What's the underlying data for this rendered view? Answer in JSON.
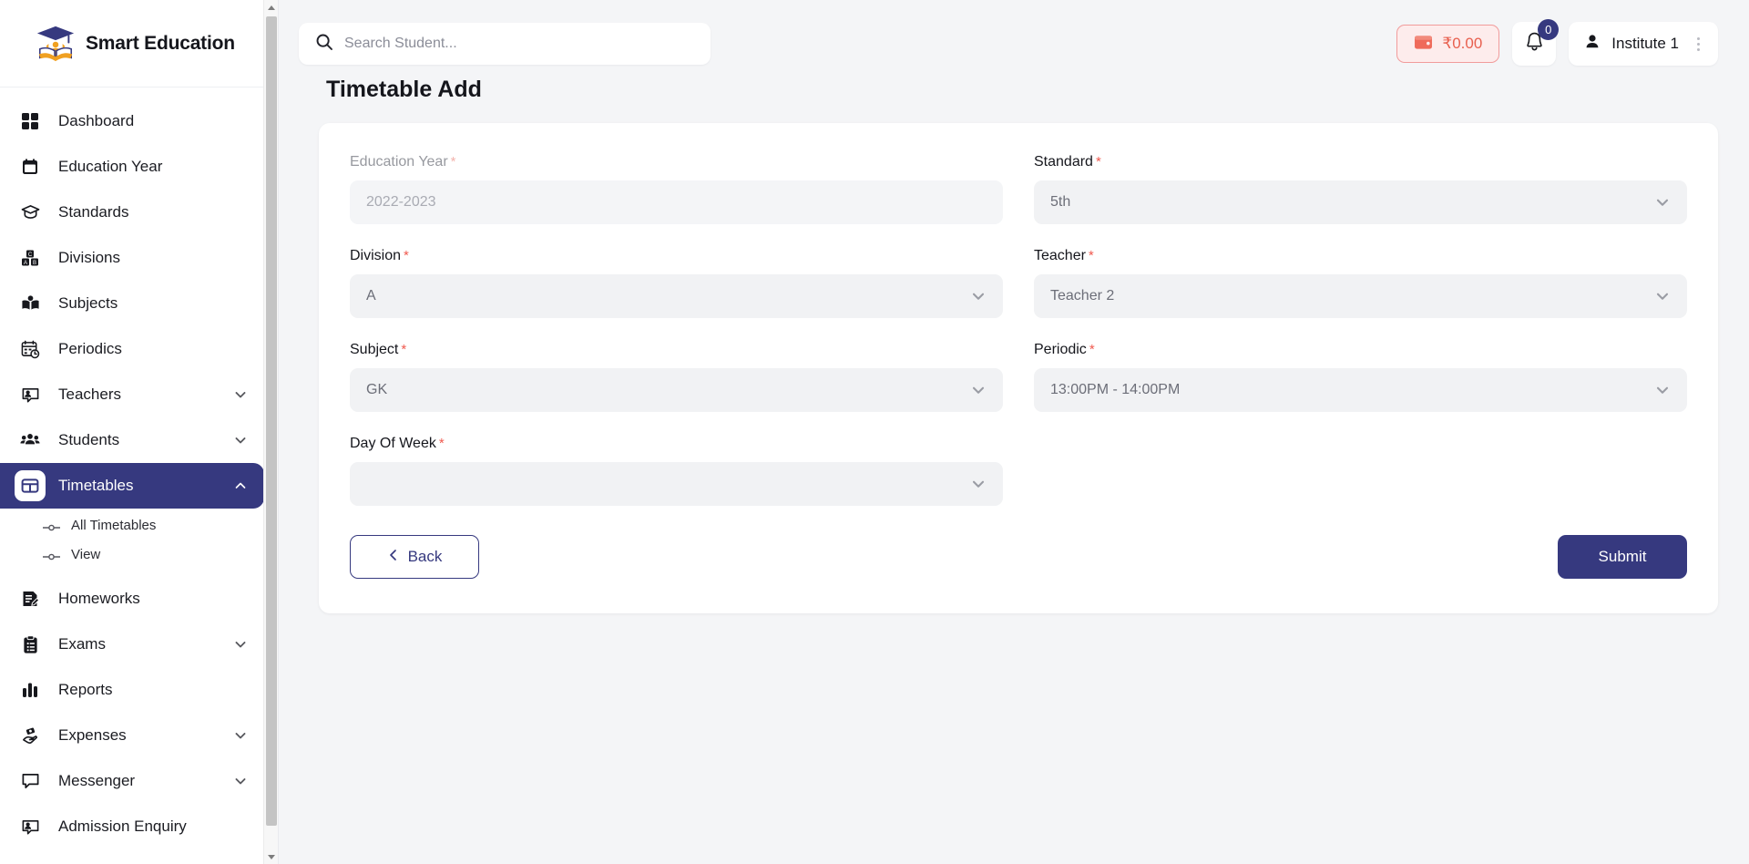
{
  "brand": {
    "name": "Smart Education",
    "logo_icon": "graduation-cap-logo"
  },
  "sidebar": {
    "items": [
      {
        "label": "Dashboard",
        "icon": "grid-squares-icon",
        "expandable": false,
        "active": false
      },
      {
        "label": "Education Year",
        "icon": "calendar-icon",
        "expandable": false,
        "active": false
      },
      {
        "label": "Standards",
        "icon": "graduation-cap-icon",
        "expandable": false,
        "active": false
      },
      {
        "label": "Divisions",
        "icon": "alphabet-blocks-icon",
        "expandable": false,
        "active": false
      },
      {
        "label": "Subjects",
        "icon": "open-book-icon",
        "expandable": false,
        "active": false
      },
      {
        "label": "Periodics",
        "icon": "calendar-clock-icon",
        "expandable": false,
        "active": false
      },
      {
        "label": "Teachers",
        "icon": "presenter-icon",
        "expandable": true,
        "active": false
      },
      {
        "label": "Students",
        "icon": "users-group-icon",
        "expandable": true,
        "active": false
      },
      {
        "label": "Timetables",
        "icon": "table-grid-icon",
        "expandable": true,
        "active": true
      },
      {
        "label": "Homeworks",
        "icon": "document-edit-icon",
        "expandable": false,
        "active": false
      },
      {
        "label": "Exams",
        "icon": "clipboard-icon",
        "expandable": true,
        "active": false
      },
      {
        "label": "Reports",
        "icon": "bar-chart-icon",
        "expandable": false,
        "active": false
      },
      {
        "label": "Expenses",
        "icon": "hand-money-icon",
        "expandable": true,
        "active": false
      },
      {
        "label": "Messenger",
        "icon": "chat-bubble-icon",
        "expandable": true,
        "active": false
      },
      {
        "label": "Admission Enquiry",
        "icon": "presenter-icon",
        "expandable": false,
        "active": false
      }
    ],
    "timetables_submenu": [
      {
        "label": "All Timetables"
      },
      {
        "label": "View"
      }
    ]
  },
  "topbar": {
    "search": {
      "placeholder": "Search Student...",
      "value": "",
      "icon": "search-icon"
    },
    "wallet": {
      "amount": "₹0.00",
      "icon": "wallet-icon"
    },
    "notifications": {
      "count": "0",
      "icon": "bell-icon"
    },
    "user": {
      "name": "Institute 1",
      "icon": "user-icon",
      "menu_icon": "kebab-menu-icon"
    }
  },
  "page": {
    "title": "Timetable Add"
  },
  "form": {
    "fields": [
      {
        "label": "Education Year",
        "required": true,
        "value": "2022-2023",
        "type": "text",
        "disabled": true,
        "name": "education-year"
      },
      {
        "label": "Standard",
        "required": true,
        "value": "5th",
        "type": "select",
        "disabled": false,
        "name": "standard"
      },
      {
        "label": "Division",
        "required": true,
        "value": "A",
        "type": "select",
        "disabled": false,
        "name": "division"
      },
      {
        "label": "Teacher",
        "required": true,
        "value": "Teacher 2",
        "type": "select",
        "disabled": false,
        "name": "teacher"
      },
      {
        "label": "Subject",
        "required": true,
        "value": "GK",
        "type": "select",
        "disabled": false,
        "name": "subject"
      },
      {
        "label": "Periodic",
        "required": true,
        "value": "13:00PM - 14:00PM",
        "type": "select",
        "disabled": false,
        "name": "periodic"
      },
      {
        "label": "Day Of Week",
        "required": true,
        "value": "",
        "type": "select",
        "disabled": false,
        "name": "day-of-week"
      }
    ],
    "back_label": "Back",
    "submit_label": "Submit"
  },
  "colors": {
    "accent_navy": "#36397f",
    "wallet_red": "#e8604f",
    "required_red": "#f05a4f",
    "page_bg": "#f4f5f7",
    "control_bg": "#f1f2f4"
  }
}
